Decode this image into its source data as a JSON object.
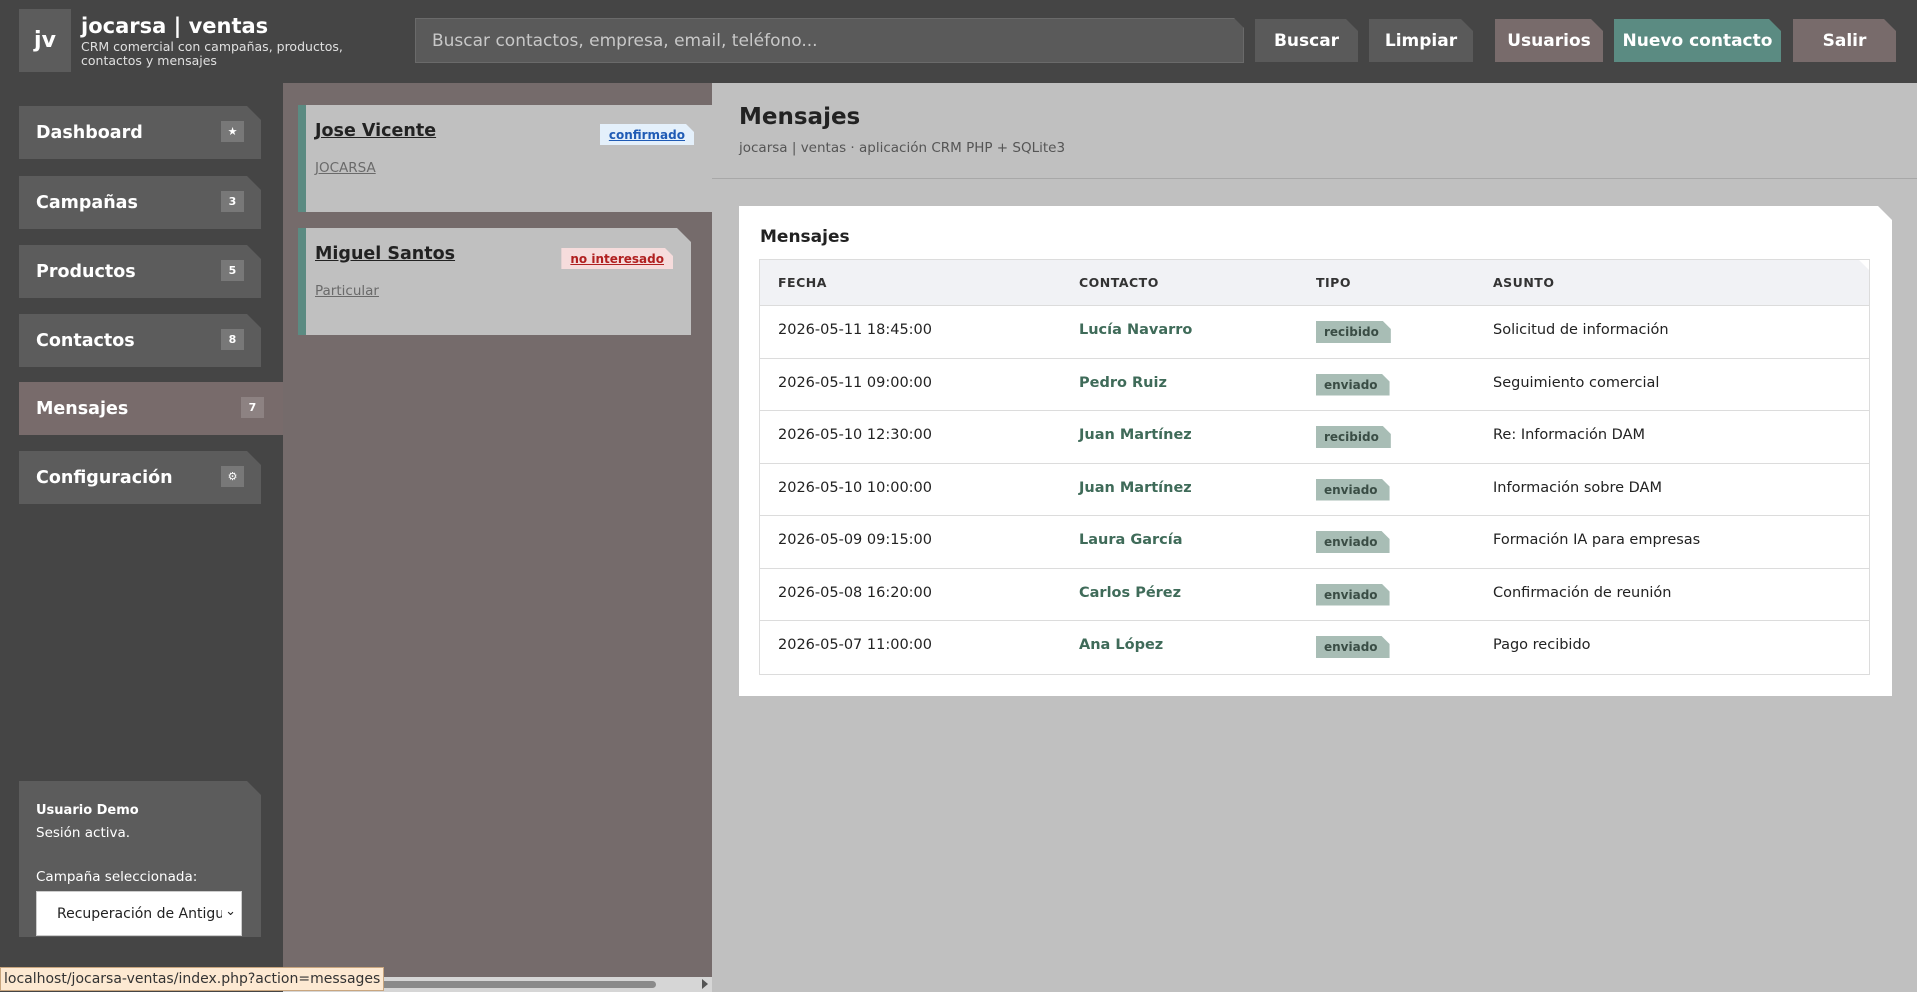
{
  "header": {
    "logo": "jv",
    "title": "jocarsa | ventas",
    "subtitle": "CRM comercial con campañas, productos, contactos y mensajes",
    "search_placeholder": "Buscar contactos, empresa, email, teléfono...",
    "buttons": {
      "buscar": "Buscar",
      "limpiar": "Limpiar",
      "usuarios": "Usuarios",
      "nuevo": "Nuevo contacto",
      "salir": "Salir"
    }
  },
  "sidebar": {
    "items": [
      {
        "label": "Dashboard",
        "badge": "★"
      },
      {
        "label": "Campañas",
        "badge": "3"
      },
      {
        "label": "Productos",
        "badge": "5"
      },
      {
        "label": "Contactos",
        "badge": "8"
      },
      {
        "label": "Mensajes",
        "badge": "7",
        "active": true
      },
      {
        "label": "Configuración",
        "badge": "⚙"
      }
    ],
    "user": {
      "name": "Usuario Demo",
      "session": "Sesión activa.",
      "campaign_label": "Campaña seleccionada:",
      "campaign_value": "Recuperación de Antigu",
      "chevron": "⌄"
    }
  },
  "contacts_panel": {
    "cards": [
      {
        "name": "Jose Vicente",
        "org": "JOCARSA",
        "status": "confirmado"
      },
      {
        "name": "Miguel Santos",
        "org": "Particular",
        "status": "no interesado"
      }
    ]
  },
  "main": {
    "title": "Mensajes",
    "subtitle": "jocarsa | ventas · aplicación CRM PHP + SQLite3",
    "panel_title": "Mensajes",
    "columns": [
      "FECHA",
      "CONTACTO",
      "TIPO",
      "ASUNTO"
    ],
    "rows": [
      {
        "fecha": "2026-05-11 18:45:00",
        "contacto": "Lucía Navarro",
        "tipo": "recibido",
        "asunto": "Solicitud de información"
      },
      {
        "fecha": "2026-05-11 09:00:00",
        "contacto": "Pedro Ruiz",
        "tipo": "enviado",
        "asunto": "Seguimiento comercial"
      },
      {
        "fecha": "2026-05-10 12:30:00",
        "contacto": "Juan Martínez",
        "tipo": "recibido",
        "asunto": "Re: Información DAM"
      },
      {
        "fecha": "2026-05-10 10:00:00",
        "contacto": "Juan Martínez",
        "tipo": "enviado",
        "asunto": "Información sobre DAM"
      },
      {
        "fecha": "2026-05-09 09:15:00",
        "contacto": "Laura García",
        "tipo": "enviado",
        "asunto": "Formación IA para empresas"
      },
      {
        "fecha": "2026-05-08 16:20:00",
        "contacto": "Carlos Pérez",
        "tipo": "enviado",
        "asunto": "Confirmación de reunión"
      },
      {
        "fecha": "2026-05-07 11:00:00",
        "contacto": "Ana López",
        "tipo": "enviado",
        "asunto": "Pago recibido"
      }
    ]
  },
  "statusbar": {
    "url": "localhost/jocarsa-ventas/index.php?action=messages"
  },
  "colors": {
    "accent": "#5b8b82",
    "muted_button": "#786b6b",
    "dark_bg": "#454545"
  }
}
